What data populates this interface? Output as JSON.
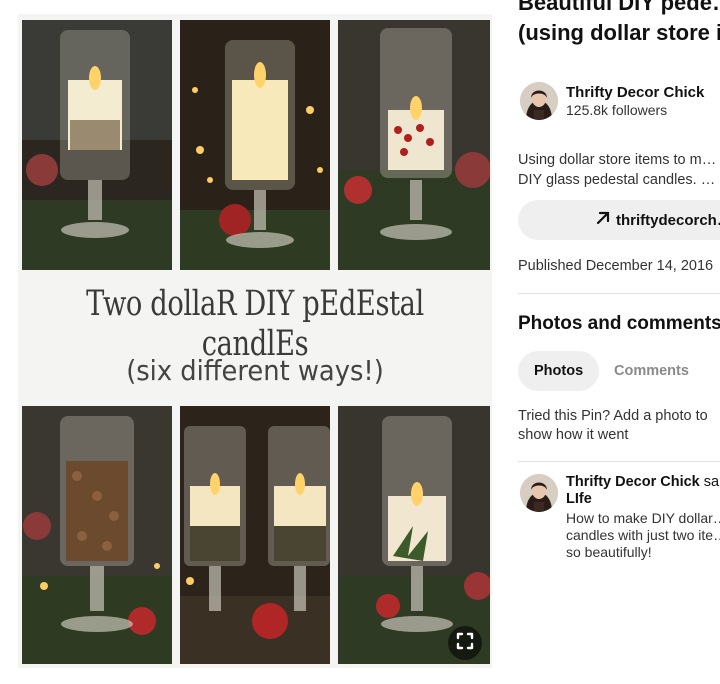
{
  "pin": {
    "title_line1": "Beautiful DIY pede…",
    "title_line2": "(using dollar store i…",
    "image_title": "Two dollaR DIY pEdEstal candlEs",
    "image_subtitle": "(six different ways!)"
  },
  "creator": {
    "name": "Thrifty Decor Chick",
    "followers": "125.8k followers"
  },
  "description_line1": "Using dollar store items to m…",
  "description_line2": "DIY glass pedestal candles. …",
  "link_label": "thriftydecorch…",
  "published": "Published December 14, 2016",
  "comments_section": {
    "heading": "Photos and comments",
    "tab_photos": "Photos",
    "tab_comments": "Comments",
    "tried_text": "Tried this Pin? Add a photo to show how it went"
  },
  "comment": {
    "author": "Thrifty Decor Chick",
    "action": " sa…",
    "author_line2": "LIfe",
    "text_line1": "How to make DIY dollar…",
    "text_line2": "candles with just two ite…",
    "text_line3": "so beautifully!"
  },
  "icons": {
    "expand": "expand-corners-icon",
    "link": "arrow-up-right-icon"
  },
  "colors": {
    "button_bg": "#efefef",
    "muted_text": "#8a8a8a"
  }
}
